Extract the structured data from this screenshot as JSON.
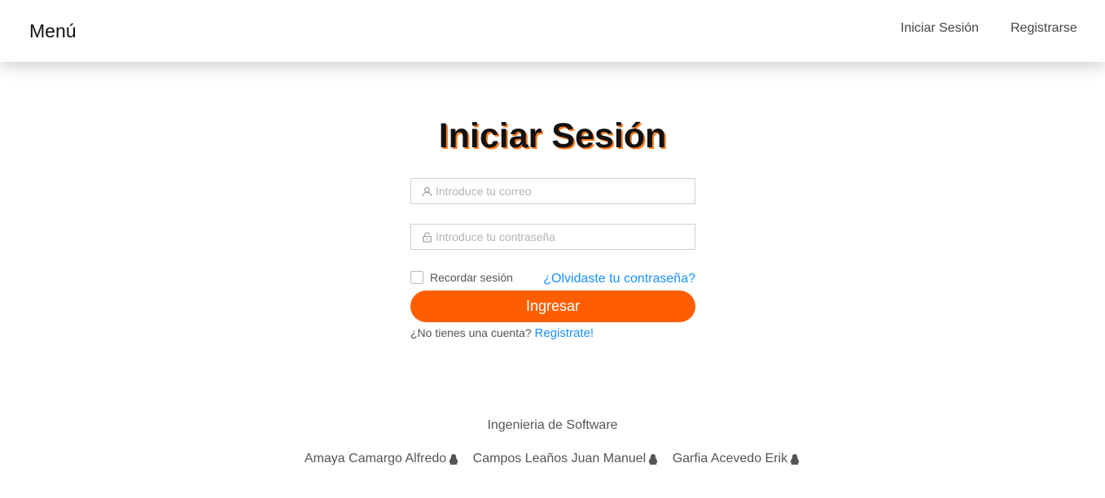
{
  "header": {
    "brand": "Menú",
    "nav": [
      {
        "label": "Iniciar Sesión"
      },
      {
        "label": "Registrarse"
      }
    ]
  },
  "login": {
    "title": "Iniciar Sesión",
    "email": {
      "placeholder": "Introduce tu correo",
      "value": "",
      "icon": "user-icon"
    },
    "password": {
      "placeholder": "Introduce tu contraseña",
      "value": "",
      "icon": "lock-icon"
    },
    "remember_label": "Recordar sesión",
    "remember_checked": false,
    "forgot_label": "¿Olvidaste tu contraseña?",
    "submit_label": "Ingresar",
    "signup_prompt": "¿No tienes una cuenta?",
    "signup_link": "Registrate!"
  },
  "footer": {
    "title": "Ingenieria de Software",
    "authors": [
      {
        "name": "Amaya Camargo Alfredo",
        "icon": "linux-penguin-icon"
      },
      {
        "name": "Campos Leaños Juan Manuel",
        "icon": "linux-penguin-icon"
      },
      {
        "name": "Garfia Acevedo Erik",
        "icon": "linux-penguin-icon"
      }
    ]
  },
  "colors": {
    "accent": "#ff5e00",
    "title_shadow": "#ff7a1a",
    "link": "#1890ff"
  }
}
